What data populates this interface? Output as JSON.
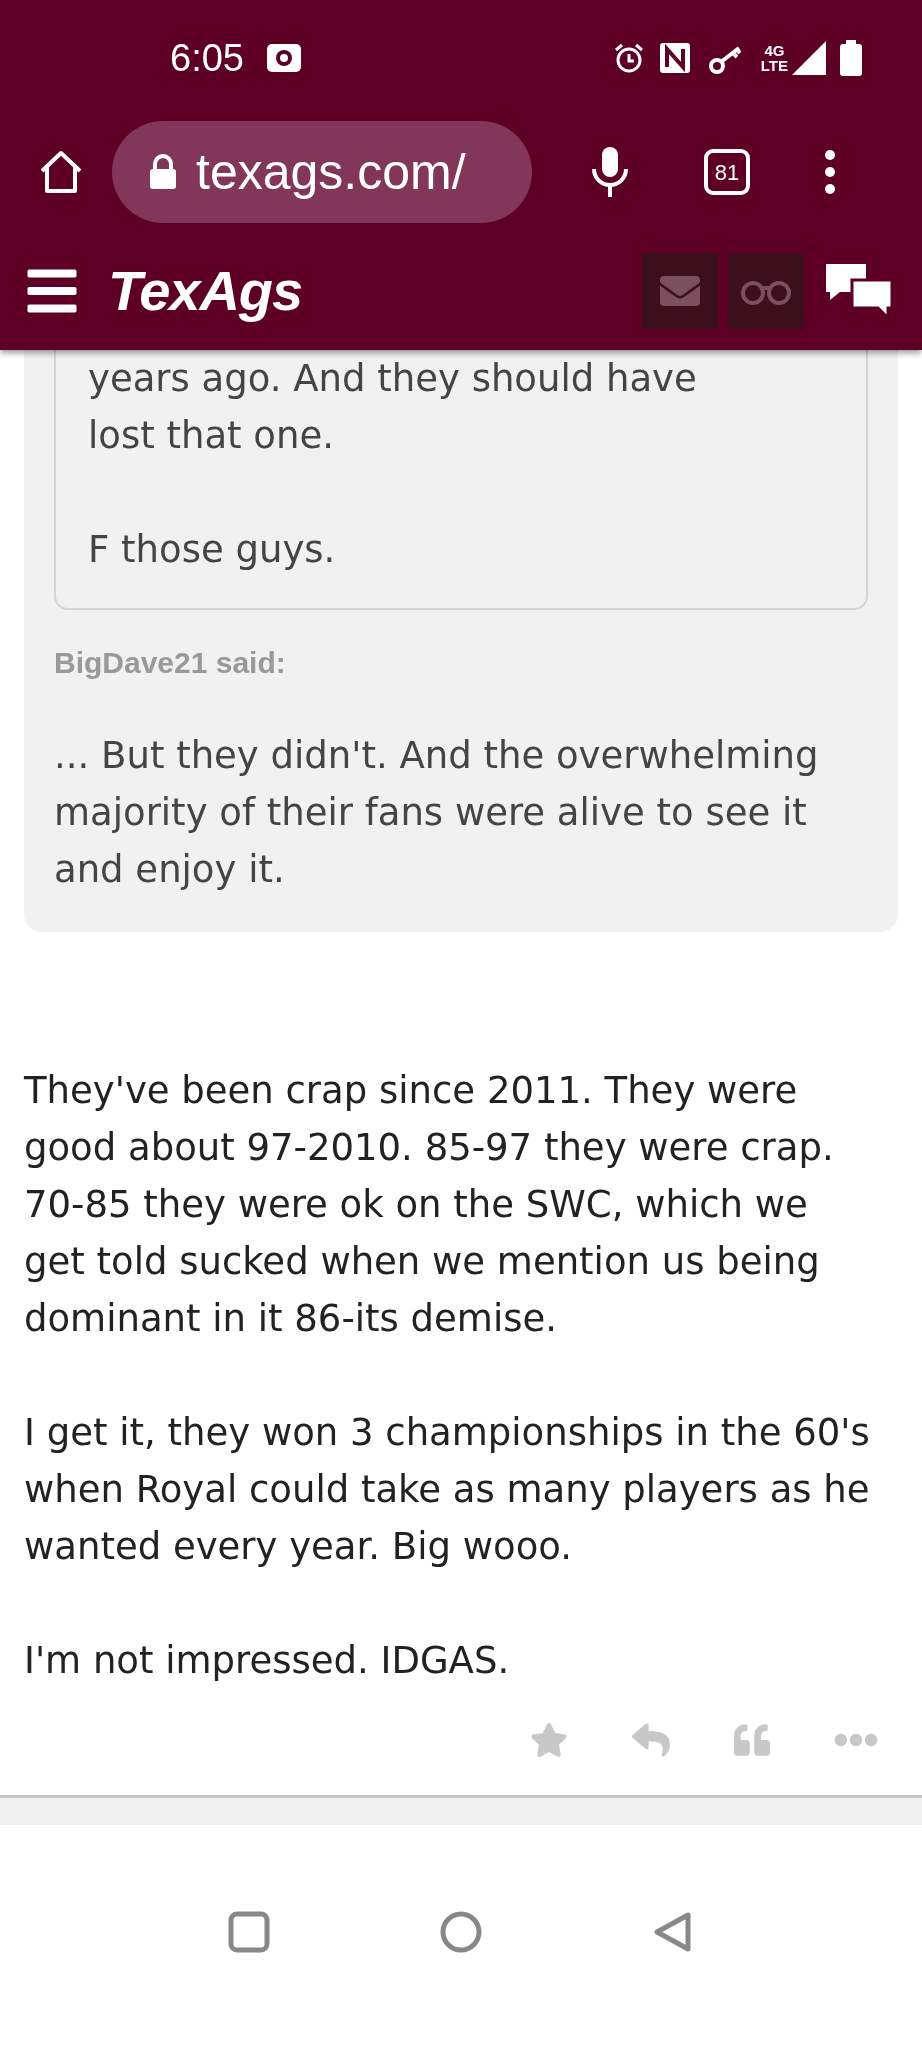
{
  "status_bar": {
    "time": "6:05",
    "network": "4G",
    "network_sub": "LTE"
  },
  "browser": {
    "url": "texags.com/",
    "tab_count": "81"
  },
  "site_header": {
    "logo": "TexAgs"
  },
  "quote": {
    "nested_paragraphs": [
      "years ago. And they should have\nlost that one.",
      "F those guys."
    ],
    "author": "BigDave21 said:",
    "text": "... But they didn't. And the overwhelming majority of their fans were alive to see it and enjoy it."
  },
  "post": {
    "paragraphs": [
      "They've been crap since 2011. They were good about 97-2010. 85-97 they were crap. 70-85 they were ok on the SWC, which we get told sucked when we mention us being dominant in it 86-its demise.",
      "I get it, they won 3 championships in the 60's when Royal could take as many players as he wanted every year. Big wooo.",
      "I'm not impressed. IDGAS."
    ]
  }
}
